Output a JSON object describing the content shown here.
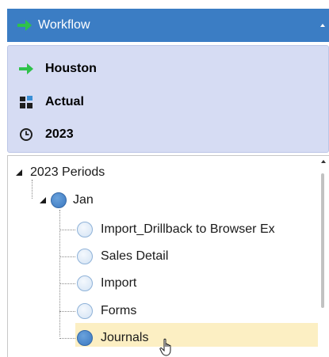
{
  "header": {
    "title": "Workflow",
    "icon": "green-arrow-icon",
    "collapse_icon": "collapse-caret-icon"
  },
  "context": {
    "items": [
      {
        "icon": "green-arrow-icon",
        "label": "Houston"
      },
      {
        "icon": "scenario-blocks-icon",
        "label": "Actual"
      },
      {
        "icon": "clock-icon",
        "label": "2023"
      }
    ]
  },
  "tree": {
    "root": {
      "label": "2023 Periods",
      "expanded": true
    },
    "period": {
      "label": "Jan",
      "expanded": true
    },
    "steps": [
      {
        "label": "Import_Drillback to Browser Ex",
        "status": "empty"
      },
      {
        "label": "Sales Detail",
        "status": "empty"
      },
      {
        "label": "Import",
        "status": "empty"
      },
      {
        "label": "Forms",
        "status": "empty"
      },
      {
        "label": "Journals",
        "status": "filled",
        "selected": true
      }
    ]
  },
  "colors": {
    "header_bg": "#3b7dc4",
    "context_bg": "#d6dcf3",
    "selected_bg": "#fcefc3",
    "accent_green": "#2ec24a",
    "node_blue": "#3b78c0"
  }
}
